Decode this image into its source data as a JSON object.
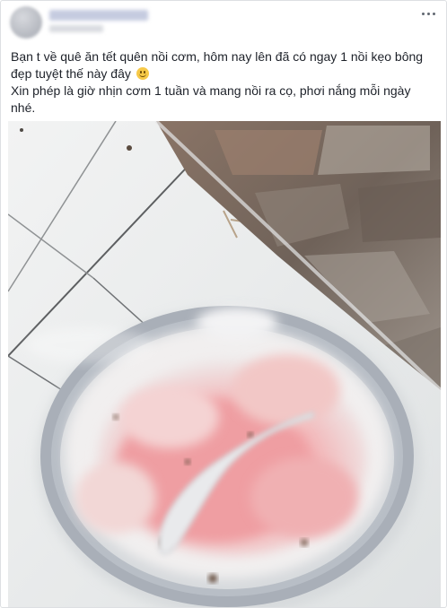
{
  "post": {
    "paragraph_1": "Bạn t về quê ăn tết quên nồi cơm, hôm nay lên đã có ngay 1 nồi kẹo bông đẹp tuyệt thế này đây",
    "emoji_icon": "smile-emoji",
    "paragraph_2": "Xin phép là giờ nhịn cơm 1 tuần và mang nồi ra cọ, phơi nắng mỗi ngày nhé.",
    "menu_icon": "more-options-icon",
    "photo_subject": "moldy-rice-pot-photo"
  },
  "colors": {
    "text": "#1d2129",
    "secondary": "#606770",
    "border": "#dddfe2",
    "tile": "#e9ebec",
    "pot_rim": "#a4aab3",
    "mold_pink": "#ee9a9f",
    "mold_white": "#f1efef"
  }
}
